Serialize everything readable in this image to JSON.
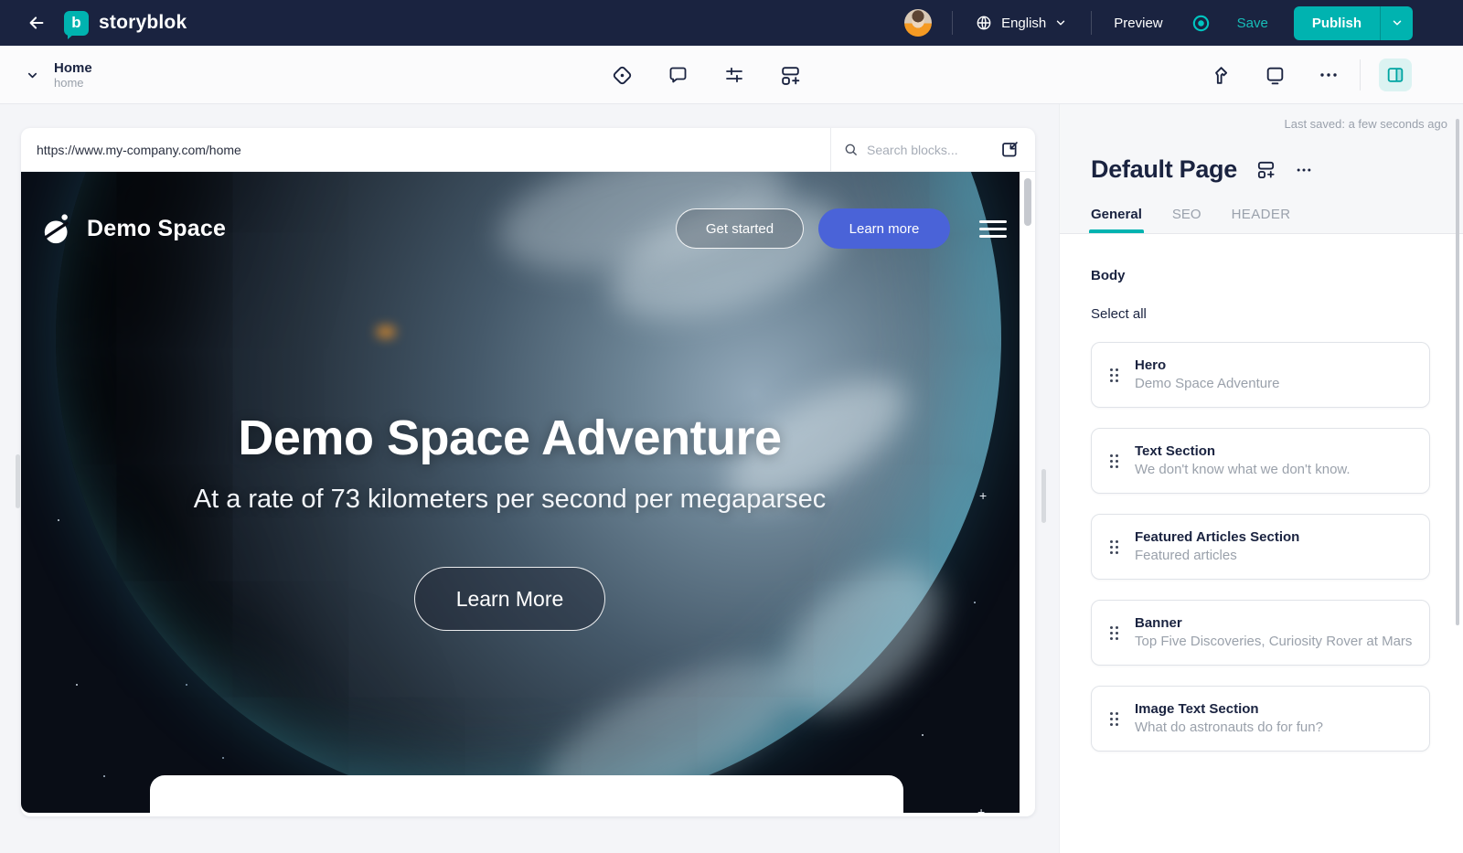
{
  "topbar": {
    "logo_text": "storyblok",
    "language": "English",
    "preview_label": "Preview",
    "save_label": "Save",
    "publish_label": "Publish"
  },
  "breadcrumb": {
    "title": "Home",
    "slug": "home"
  },
  "preview": {
    "url": "https://www.my-company.com/home",
    "search_placeholder": "Search blocks..."
  },
  "site": {
    "brand": "Demo Space",
    "get_started": "Get started",
    "learn_more_nav": "Learn more",
    "hero_title": "Demo Space Adventure",
    "hero_subtitle": "At a rate of 73 kilometers per second per megaparsec",
    "hero_cta": "Learn More"
  },
  "sidebar": {
    "last_saved": "Last saved: a few seconds ago",
    "title": "Default Page",
    "tabs": [
      "General",
      "SEO",
      "HEADER"
    ],
    "body_label": "Body",
    "select_all": "Select all",
    "blocks": [
      {
        "name": "Hero",
        "summary": "Demo Space Adventure"
      },
      {
        "name": "Text Section",
        "summary": "We don't know what we don't know."
      },
      {
        "name": "Featured Articles Section",
        "summary": "Featured articles"
      },
      {
        "name": "Banner",
        "summary": "Top Five Discoveries, Curiosity Rover at Mars"
      },
      {
        "name": "Image Text Section",
        "summary": "What do astronauts do for fun?"
      }
    ]
  },
  "colors": {
    "teal": "#00b3b0",
    "navy": "#1a2340",
    "blue": "#4a63d8"
  }
}
